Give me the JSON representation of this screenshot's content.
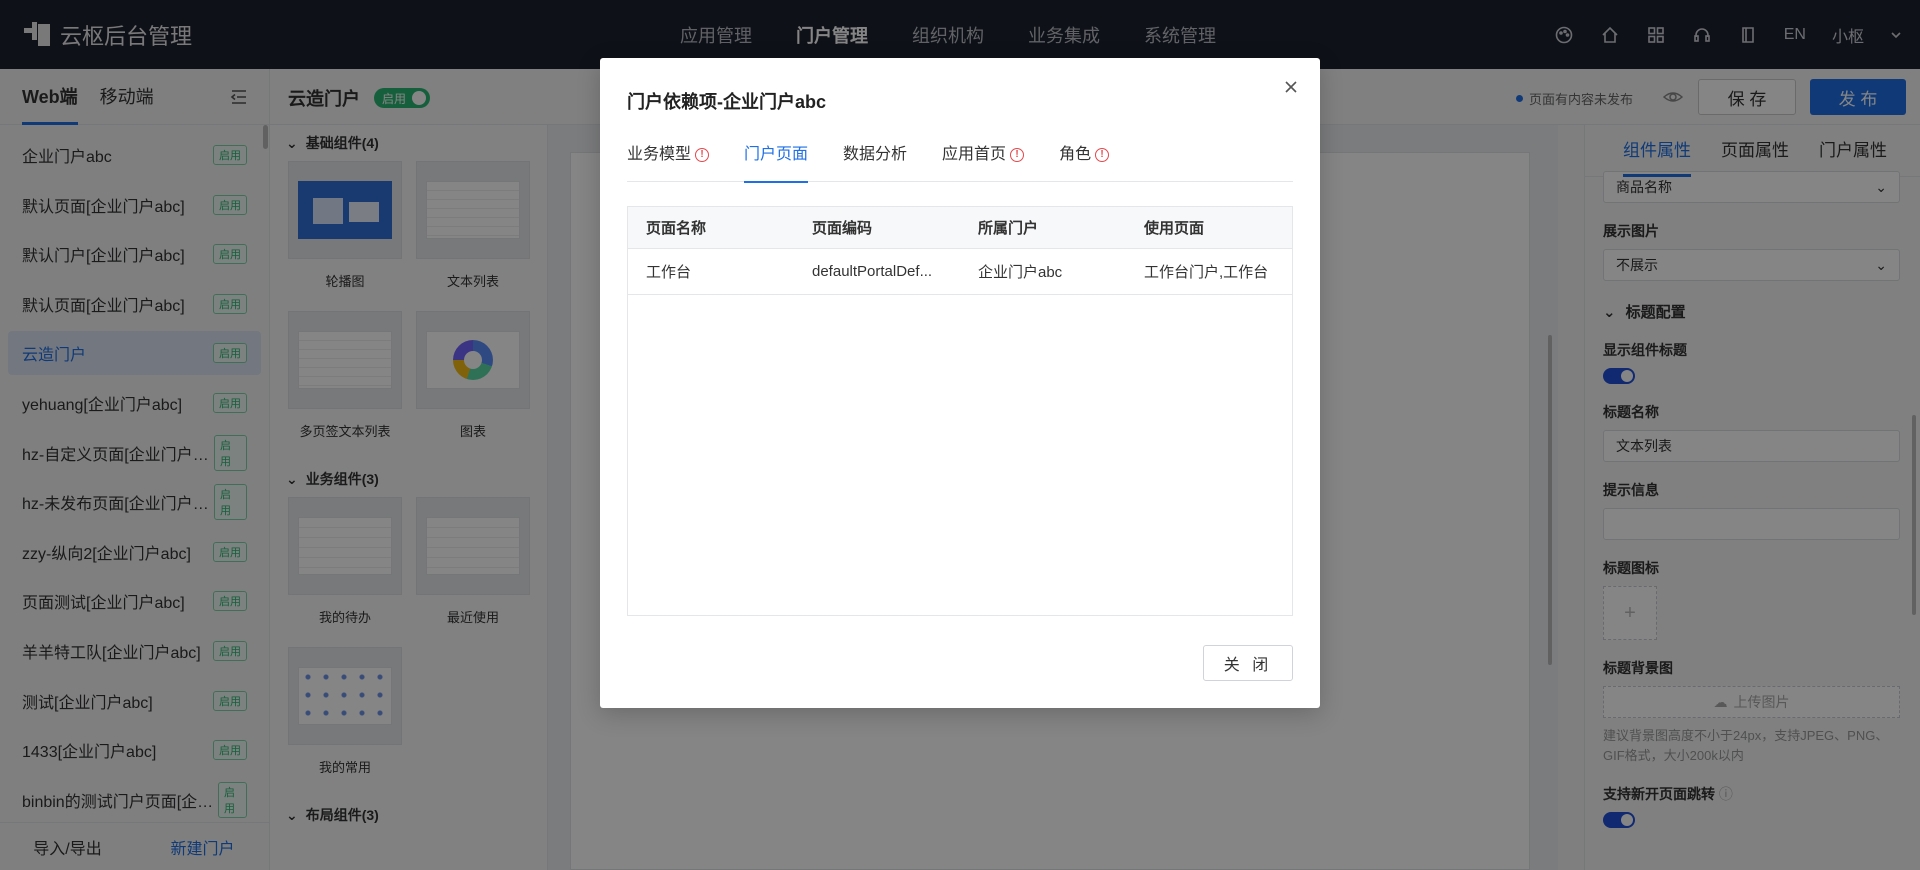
{
  "app": {
    "title": "云枢后台管理"
  },
  "topnav": {
    "items": [
      "应用管理",
      "门户管理",
      "组织机构",
      "业务集成",
      "系统管理"
    ],
    "active_index": 1
  },
  "topbar": {
    "lang": "EN",
    "user": "小枢"
  },
  "sidebar": {
    "tabs": [
      "Web端",
      "移动端"
    ],
    "active_tab": 0,
    "items": [
      {
        "label": "企业门户abc",
        "badge": "启用"
      },
      {
        "label": "默认页面[企业门户abc]",
        "badge": "启用"
      },
      {
        "label": "默认门户[企业门户abc]",
        "badge": "启用"
      },
      {
        "label": "默认页面[企业门户abc]",
        "badge": "启用"
      },
      {
        "label": "云造门户",
        "badge": "启用"
      },
      {
        "label": "yehuang[企业门户abc]",
        "badge": "启用"
      },
      {
        "label": "hz-自定义页面[企业门户abc]",
        "badge": "启用"
      },
      {
        "label": "hz-未发布页面[企业门户abc]",
        "badge": "启用"
      },
      {
        "label": "zzy-纵向2[企业门户abc]",
        "badge": "启用"
      },
      {
        "label": "页面测试[企业门户abc]",
        "badge": "启用"
      },
      {
        "label": "羊羊特工队[企业门户abc]",
        "badge": "启用"
      },
      {
        "label": "测试[企业门户abc]",
        "badge": "启用"
      },
      {
        "label": "1433[企业门户abc]",
        "badge": "启用"
      },
      {
        "label": "binbin的测试门户页面[企业门户abc]",
        "badge": "启用"
      }
    ],
    "selected_index": 4,
    "footer": {
      "import_export": "导入/导出",
      "new_portal": "新建门户"
    }
  },
  "editor": {
    "title": "云造门户",
    "status": "启用",
    "unpublished_note": "页面有内容未发布",
    "save_label": "保 存",
    "publish_label": "发 布"
  },
  "palette": {
    "groups": [
      {
        "title": "基础组件(4)",
        "items": [
          "轮播图",
          "文本列表",
          "多页签文本列表",
          "图表"
        ]
      },
      {
        "title": "业务组件(3)",
        "items": [
          "我的待办",
          "最近使用",
          "我的常用"
        ]
      },
      {
        "title": "布局组件(3)",
        "items": []
      }
    ]
  },
  "props": {
    "tabs": [
      "组件属性",
      "页面属性",
      "门户属性"
    ],
    "active_tab": 0,
    "top_select": "商品名称",
    "show_image_label": "展示图片",
    "show_image_value": "不展示",
    "title_config_section": "标题配置",
    "show_title_label": "显示组件标题",
    "title_name_label": "标题名称",
    "title_name_value": "文本列表",
    "tip_label": "提示信息",
    "tip_value": "",
    "title_icon_label": "标题图标",
    "title_bg_label": "标题背景图",
    "upload_label": "上传图片",
    "upload_hint": "建议背景图高度不小于24px，支持JPEG、PNG、GIF格式，大小200k以内",
    "new_page_jump_label": "支持新开页面跳转",
    "switch_color": "#1f4fd8"
  },
  "modal": {
    "title": "门户依赖项-企业门户abc",
    "tabs": [
      {
        "label": "业务模型",
        "warn": true
      },
      {
        "label": "门户页面",
        "warn": false
      },
      {
        "label": "数据分析",
        "warn": false
      },
      {
        "label": "应用首页",
        "warn": true
      },
      {
        "label": "角色",
        "warn": true
      }
    ],
    "active_tab": 1,
    "columns": [
      "页面名称",
      "页面编码",
      "所属门户",
      "使用页面"
    ],
    "rows": [
      [
        "工作台",
        "defaultPortalDef...",
        "企业门户abc",
        "工作台门户,工作台"
      ]
    ],
    "close_label": "关 闭"
  },
  "colors": {
    "accent": "#1f6fe5",
    "header_bg": "#1e2230",
    "status_green": "#2bb673",
    "warn_red": "#e5484d"
  }
}
